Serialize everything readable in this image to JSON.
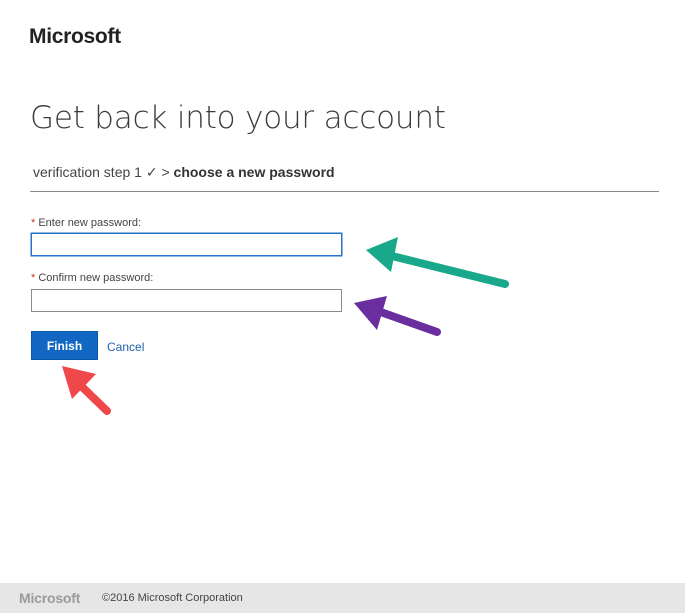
{
  "header": {
    "logo_text": "Microsoft"
  },
  "main": {
    "title": "Get back into your account",
    "breadcrumb": {
      "completed_step": "verification step 1 ✓",
      "separator": ">",
      "current_step": "choose a new password"
    },
    "form": {
      "new_password": {
        "required_mark": "*",
        "label": "Enter new password:",
        "value": ""
      },
      "confirm_password": {
        "required_mark": "*",
        "label": "Confirm new password:",
        "value": ""
      },
      "finish_label": "Finish",
      "cancel_label": "Cancel"
    },
    "annotations": {
      "new_password_arrow_color": "#1aa88a",
      "confirm_password_arrow_color": "#6a2e9e",
      "finish_arrow_color": "#f0474a"
    }
  },
  "colors": {
    "accent": "#1167c2",
    "link": "#1f61ad",
    "footer_bg": "#e6e6e6"
  },
  "footer": {
    "logo_text": "Microsoft",
    "copyright": "©2016 Microsoft Corporation"
  }
}
